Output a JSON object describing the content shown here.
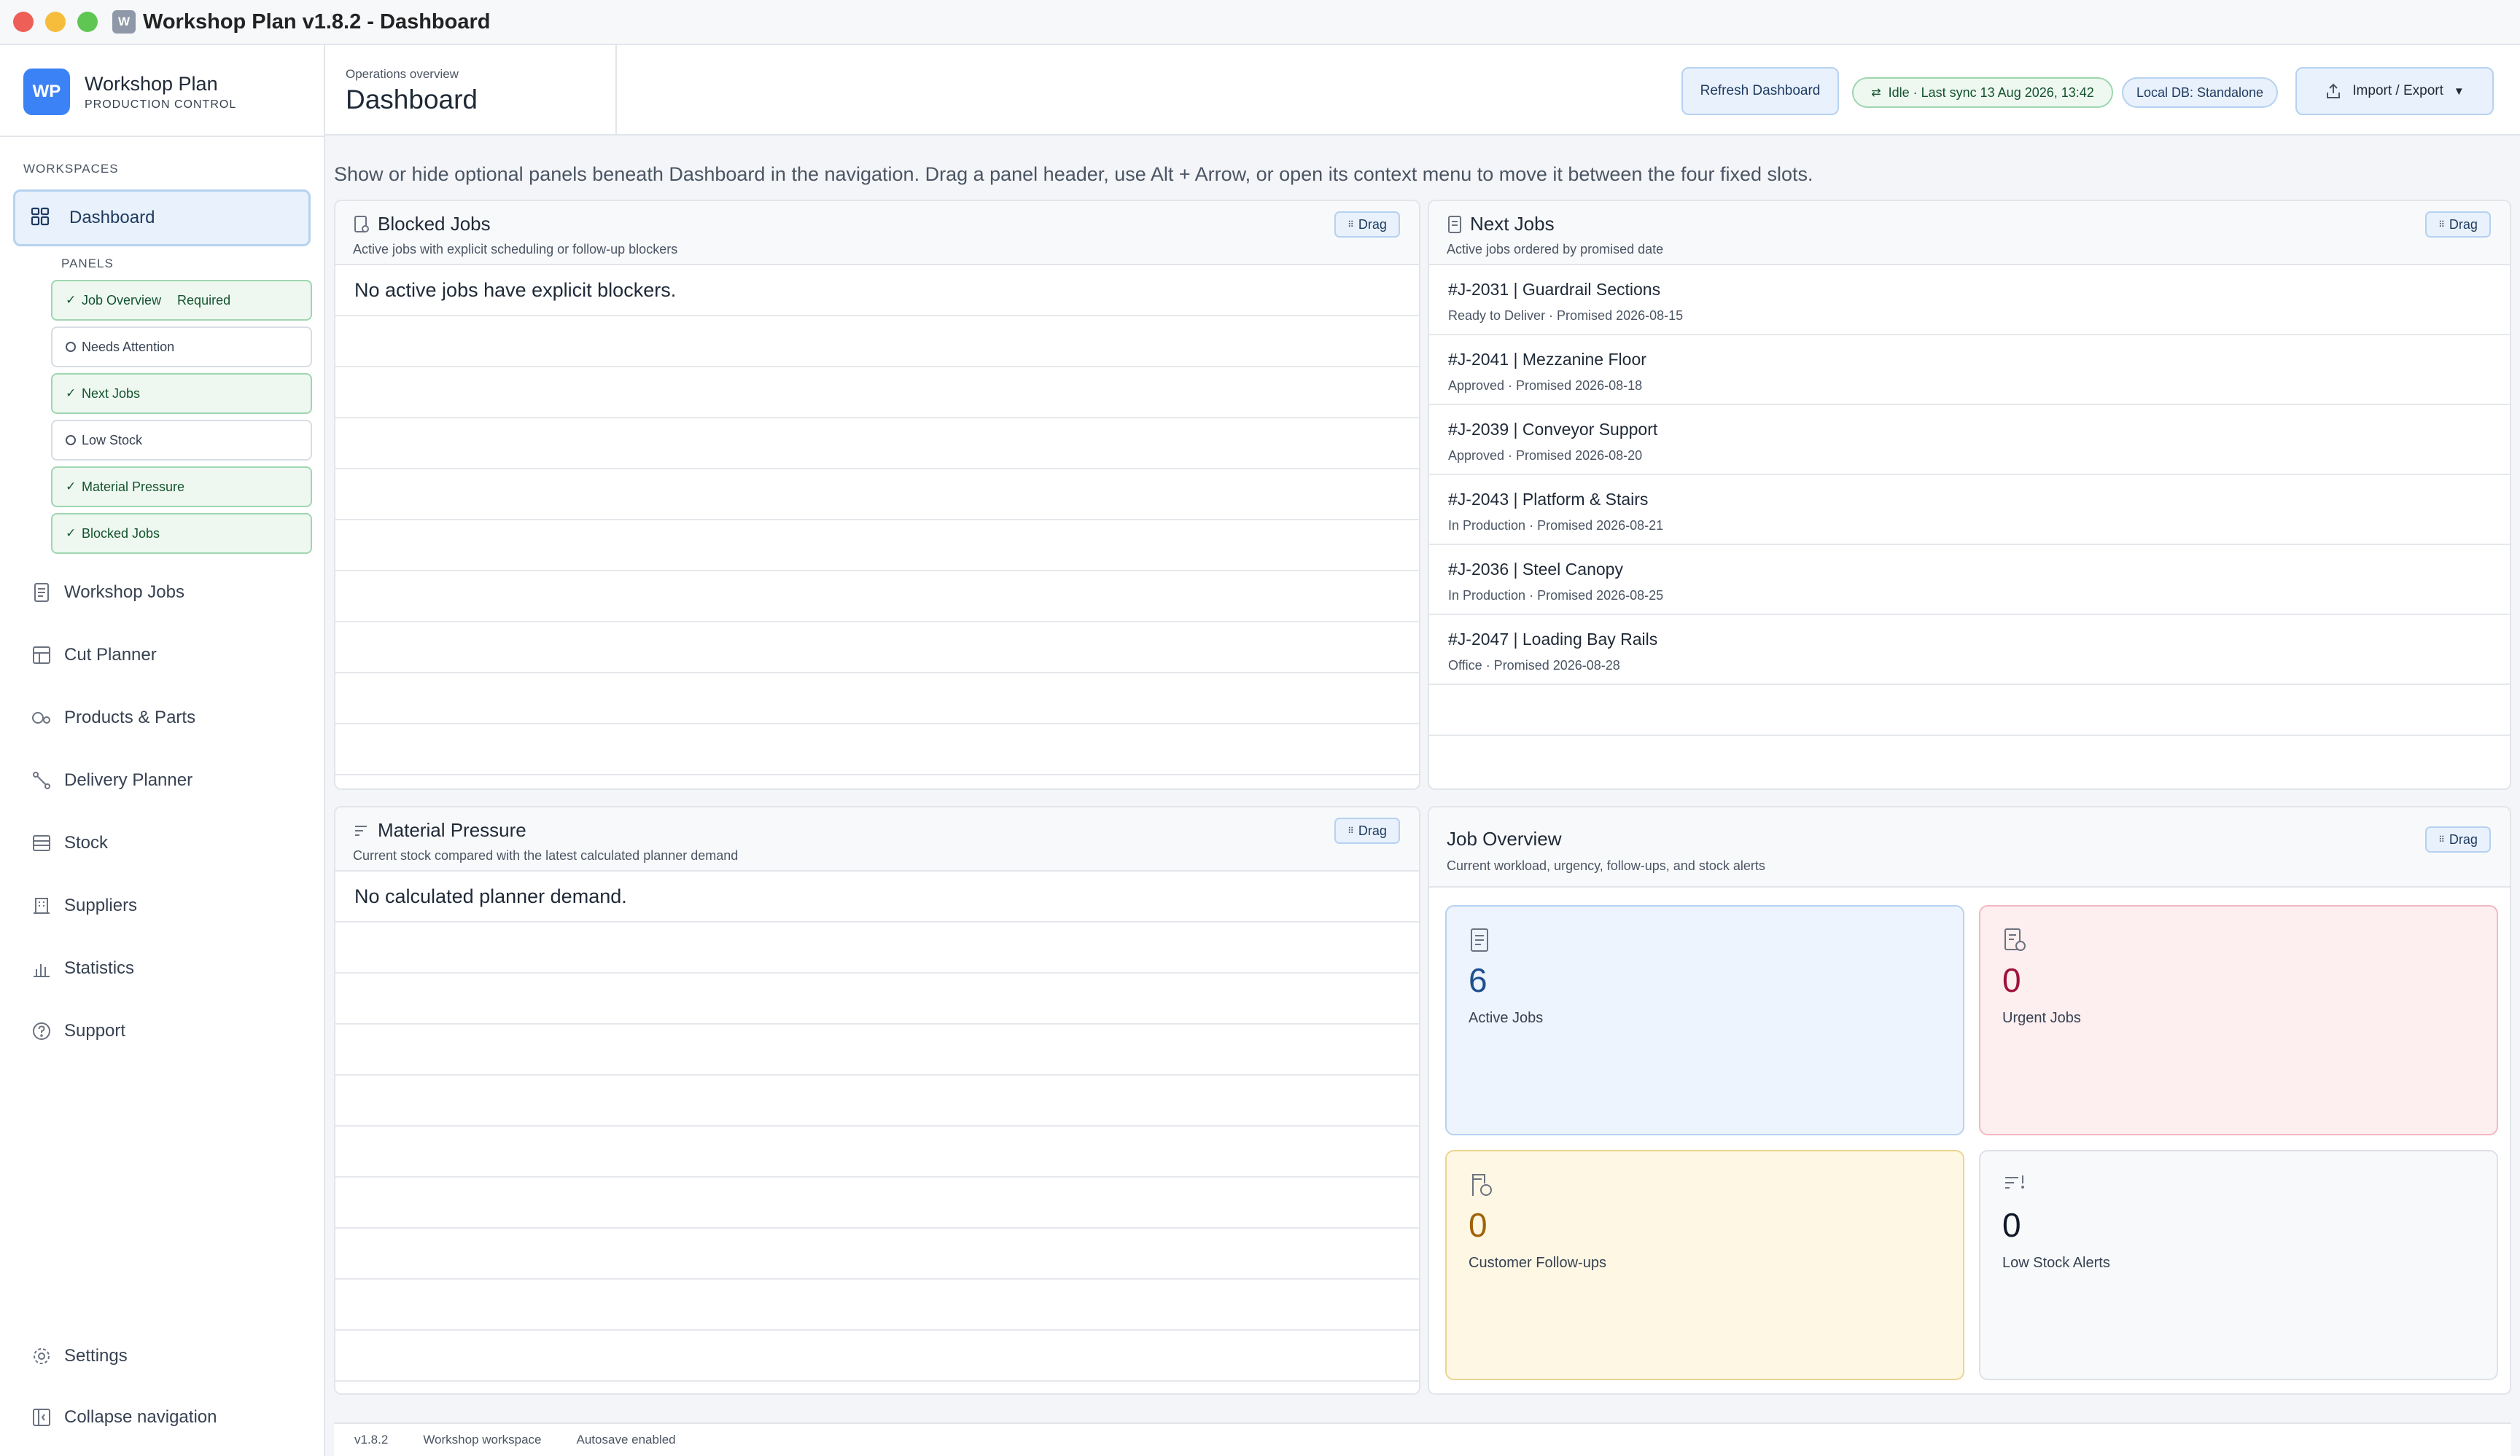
{
  "window": {
    "title": "Workshop Plan v1.8.2 - Dashboard",
    "app_glyph": "W"
  },
  "brand": {
    "logo": "WP",
    "name": "Workshop Plan",
    "subtitle": "PRODUCTION CONTROL"
  },
  "sidebar": {
    "section_label": "WORKSPACES",
    "active": {
      "label": "Dashboard",
      "icon": "dashboard-icon"
    },
    "panels_label": "PANELS",
    "panels": [
      {
        "label": "Job Overview",
        "tag": "Required",
        "enabled": true
      },
      {
        "label": "Needs Attention",
        "tag": "",
        "enabled": false
      },
      {
        "label": "Next Jobs",
        "tag": "",
        "enabled": true
      },
      {
        "label": "Low Stock",
        "tag": "",
        "enabled": false
      },
      {
        "label": "Material Pressure",
        "tag": "",
        "enabled": true
      },
      {
        "label": "Blocked Jobs",
        "tag": "",
        "enabled": true
      }
    ],
    "items": [
      {
        "label": "Workshop Jobs",
        "icon": "document-icon"
      },
      {
        "label": "Cut Planner",
        "icon": "cut-planner-icon"
      },
      {
        "label": "Products & Parts",
        "icon": "parts-icon"
      },
      {
        "label": "Delivery Planner",
        "icon": "route-icon"
      },
      {
        "label": "Stock",
        "icon": "stock-icon"
      },
      {
        "label": "Suppliers",
        "icon": "building-icon"
      },
      {
        "label": "Statistics",
        "icon": "bar-chart-icon"
      },
      {
        "label": "Support",
        "icon": "help-icon"
      }
    ],
    "bottom": [
      {
        "label": "Settings",
        "icon": "gear-icon"
      },
      {
        "label": "Collapse navigation",
        "icon": "collapse-icon"
      }
    ]
  },
  "header": {
    "crumb": "Operations overview",
    "title": "Dashboard",
    "refresh_label": "Refresh Dashboard",
    "sync_status": "Idle · Last sync 13 Aug 2026, 13:42",
    "db_status": "Local DB: Standalone",
    "import_label": "Import / Export"
  },
  "hint": "Show or hide optional panels beneath Dashboard in the navigation. Drag a panel header, use Alt + Arrow, or open its context menu to move it between the four fixed slots.",
  "drag_label": "Drag",
  "blocked": {
    "title": "Blocked Jobs",
    "subtitle": "Active jobs with explicit scheduling or follow-up blockers",
    "empty": "No active jobs have explicit blockers."
  },
  "next_jobs": {
    "title": "Next Jobs",
    "subtitle": "Active jobs ordered by promised date",
    "rows": [
      {
        "title": "#J-2031 | Guardrail Sections",
        "meta": "Ready to Deliver · Promised 2026-08-15"
      },
      {
        "title": "#J-2041 | Mezzanine Floor",
        "meta": "Approved · Promised 2026-08-18"
      },
      {
        "title": "#J-2039 | Conveyor Support",
        "meta": "Approved · Promised 2026-08-20"
      },
      {
        "title": "#J-2043 | Platform & Stairs",
        "meta": "In Production · Promised 2026-08-21"
      },
      {
        "title": "#J-2036 | Steel Canopy",
        "meta": "In Production · Promised 2026-08-25"
      },
      {
        "title": "#J-2047 | Loading Bay Rails",
        "meta": "Office · Promised 2026-08-28"
      }
    ]
  },
  "material": {
    "title": "Material Pressure",
    "subtitle": "Current stock compared with the latest calculated planner demand",
    "empty": "No calculated planner demand."
  },
  "overview": {
    "title": "Job Overview",
    "subtitle": "Current workload, urgency, follow-ups, and stock alerts",
    "stats": [
      {
        "value": "6",
        "label": "Active Jobs",
        "icon": "document-icon",
        "color": "#1e4f8f"
      },
      {
        "value": "0",
        "label": "Urgent Jobs",
        "icon": "urgent-document-icon",
        "color": "#9f1239"
      },
      {
        "value": "0",
        "label": "Customer Follow-ups",
        "icon": "follow-up-icon",
        "color": "#a16207"
      },
      {
        "value": "0",
        "label": "Low Stock Alerts",
        "icon": "low-stock-icon",
        "color": "#111827"
      }
    ]
  },
  "footer": {
    "version": "v1.8.2",
    "workspace": "Workshop workspace",
    "autosave": "Autosave enabled"
  }
}
